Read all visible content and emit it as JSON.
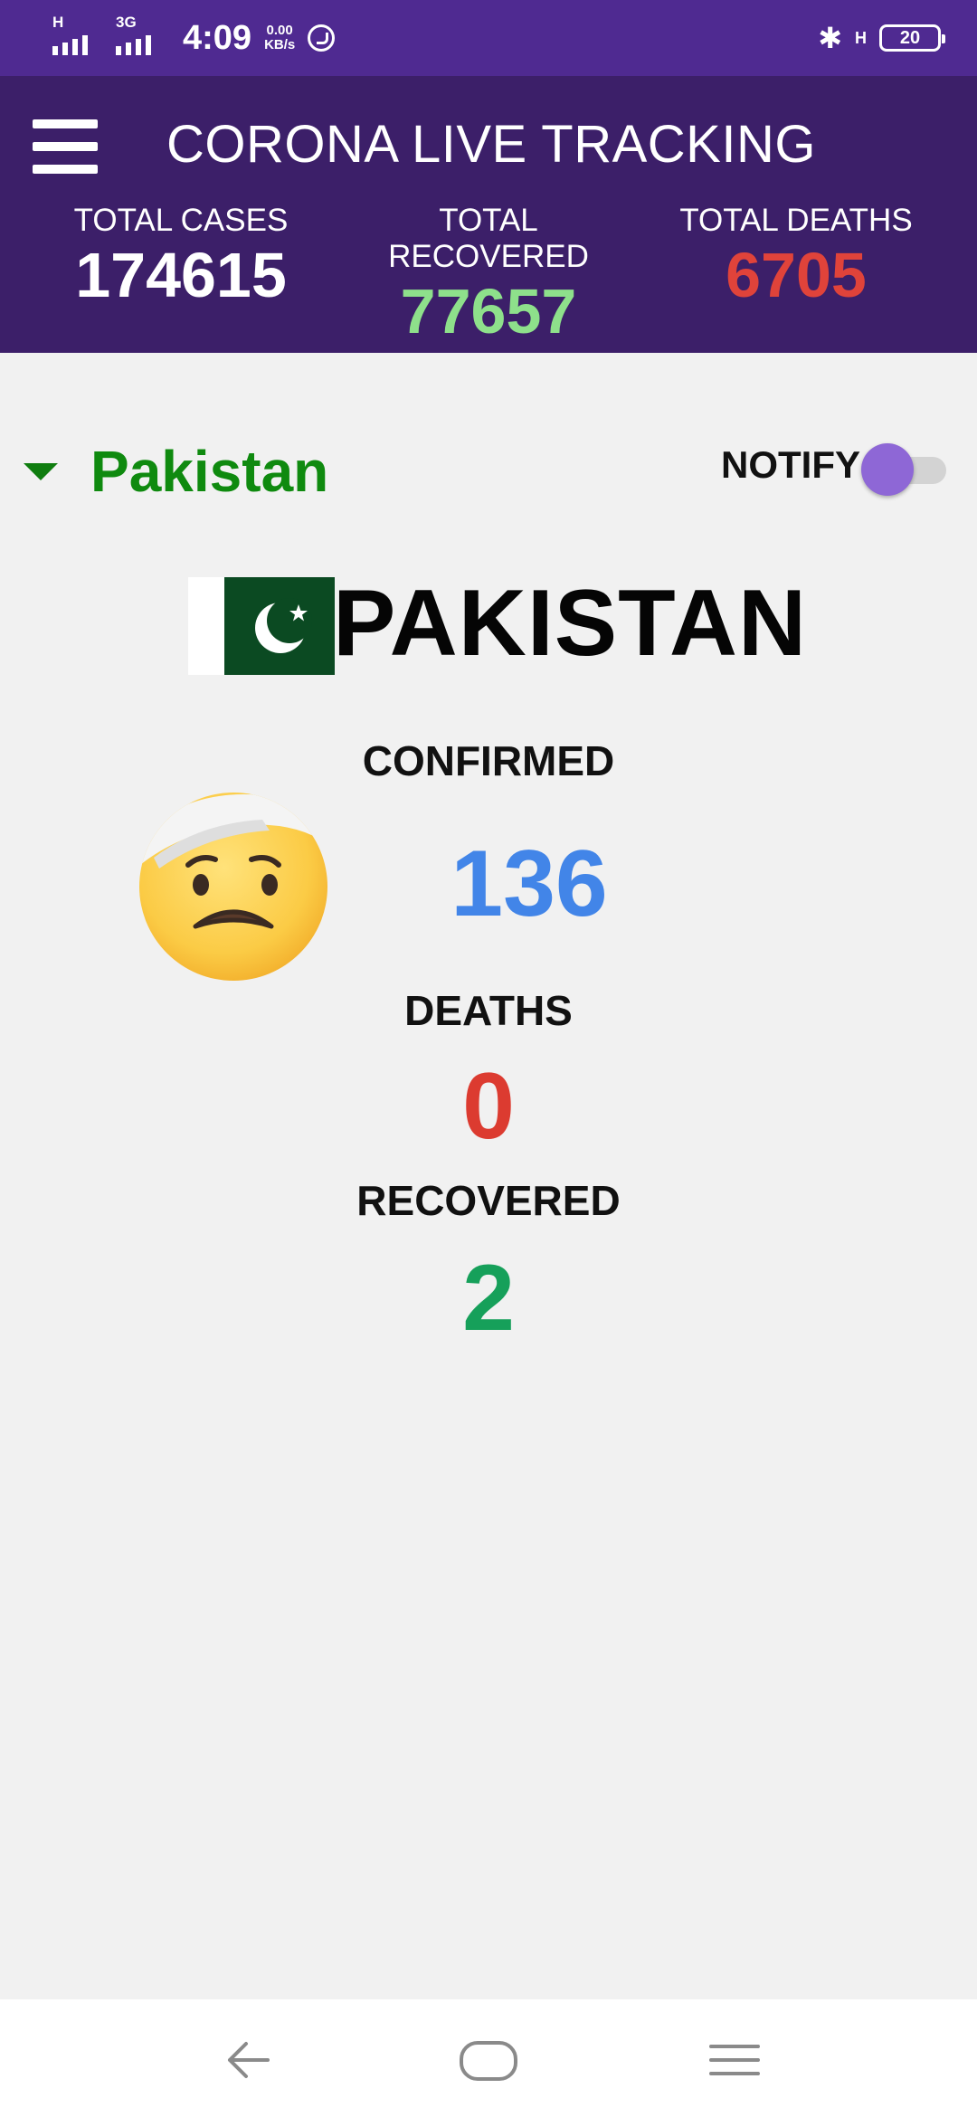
{
  "status_bar": {
    "sim1_tag": "H",
    "sim2_tag": "3G",
    "time": "4:09",
    "speed_value": "0.00",
    "speed_unit": "KB/s",
    "network_right": "H",
    "battery": "20"
  },
  "header": {
    "title": "CORONA LIVE TRACKING",
    "stats": {
      "cases_label": "TOTAL CASES",
      "cases_value": "174615",
      "recovered_label": "TOTAL RECOVERED",
      "recovered_value": "77657",
      "deaths_label": "TOTAL DEATHS",
      "deaths_value": "6705"
    }
  },
  "country_selector": {
    "selected": "Pakistan",
    "notify_label": "NOTIFY",
    "notify_on": false
  },
  "country_panel": {
    "heading": "PAKISTAN",
    "confirmed_label": "CONFIRMED",
    "confirmed_value": "136",
    "deaths_label": "DEATHS",
    "deaths_value": "0",
    "recovered_label": "RECOVERED",
    "recovered_value": "2"
  },
  "icons": {
    "menu": "hamburger-menu-icon",
    "dropdown": "caret-down-icon",
    "flag": "pakistan-flag-icon",
    "emoji": "face-with-head-bandage-icon",
    "back": "back-arrow-icon",
    "home": "home-icon",
    "recents": "menu-lines-icon"
  },
  "colors": {
    "status_bar": "#4f2a91",
    "header": "#3c1f69",
    "recovered_total": "#8ee08b",
    "deaths_total": "#e0433a",
    "country_name": "#0f8a0f",
    "confirmed": "#4285e8",
    "deaths": "#dc3b30",
    "recovered": "#16a05a",
    "toggle_thumb": "#8e67d6"
  }
}
